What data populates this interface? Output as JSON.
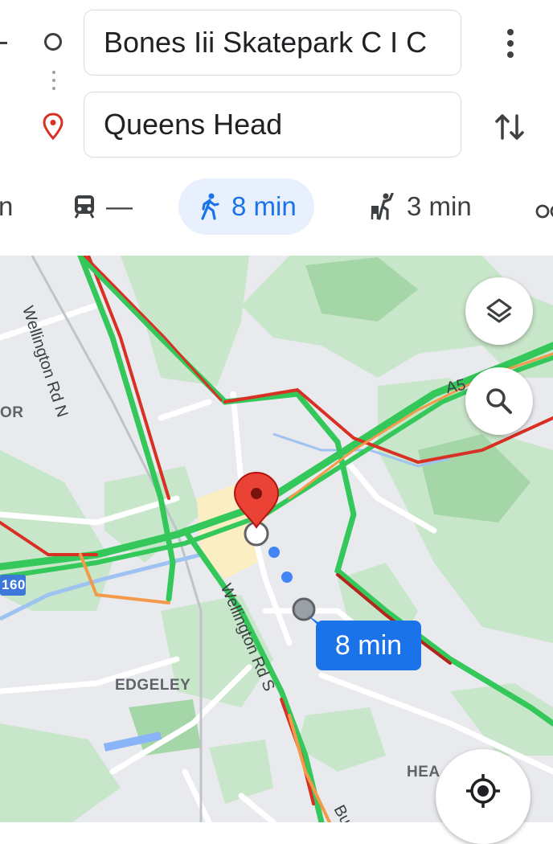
{
  "directions": {
    "origin": "Bones Iii Skatepark C I C",
    "destination": "Queens Head"
  },
  "modes": {
    "partial_left": "n",
    "transit": "—",
    "walk": "8 min",
    "ride": "3 min"
  },
  "map": {
    "labels": {
      "area_or": "OR",
      "edgeley": "EDGELEY",
      "heaton": "HEA",
      "motorway": "160",
      "a_road": "A5",
      "wellington_n": "Wellington Rd N",
      "wellington_s": "Wellington Rd S",
      "partial_bottom": "Bu"
    },
    "route_time": "8 min"
  },
  "colors": {
    "accent": "#1a73e8",
    "traffic_green": "#34c759",
    "traffic_red": "#d93025",
    "traffic_orange": "#f29a4a",
    "pin_red": "#ea4335"
  },
  "icons": {
    "more": "more-vert-icon",
    "swap": "swap-icon",
    "layers": "layers-icon",
    "search": "search-icon",
    "locate": "my-location-icon"
  }
}
